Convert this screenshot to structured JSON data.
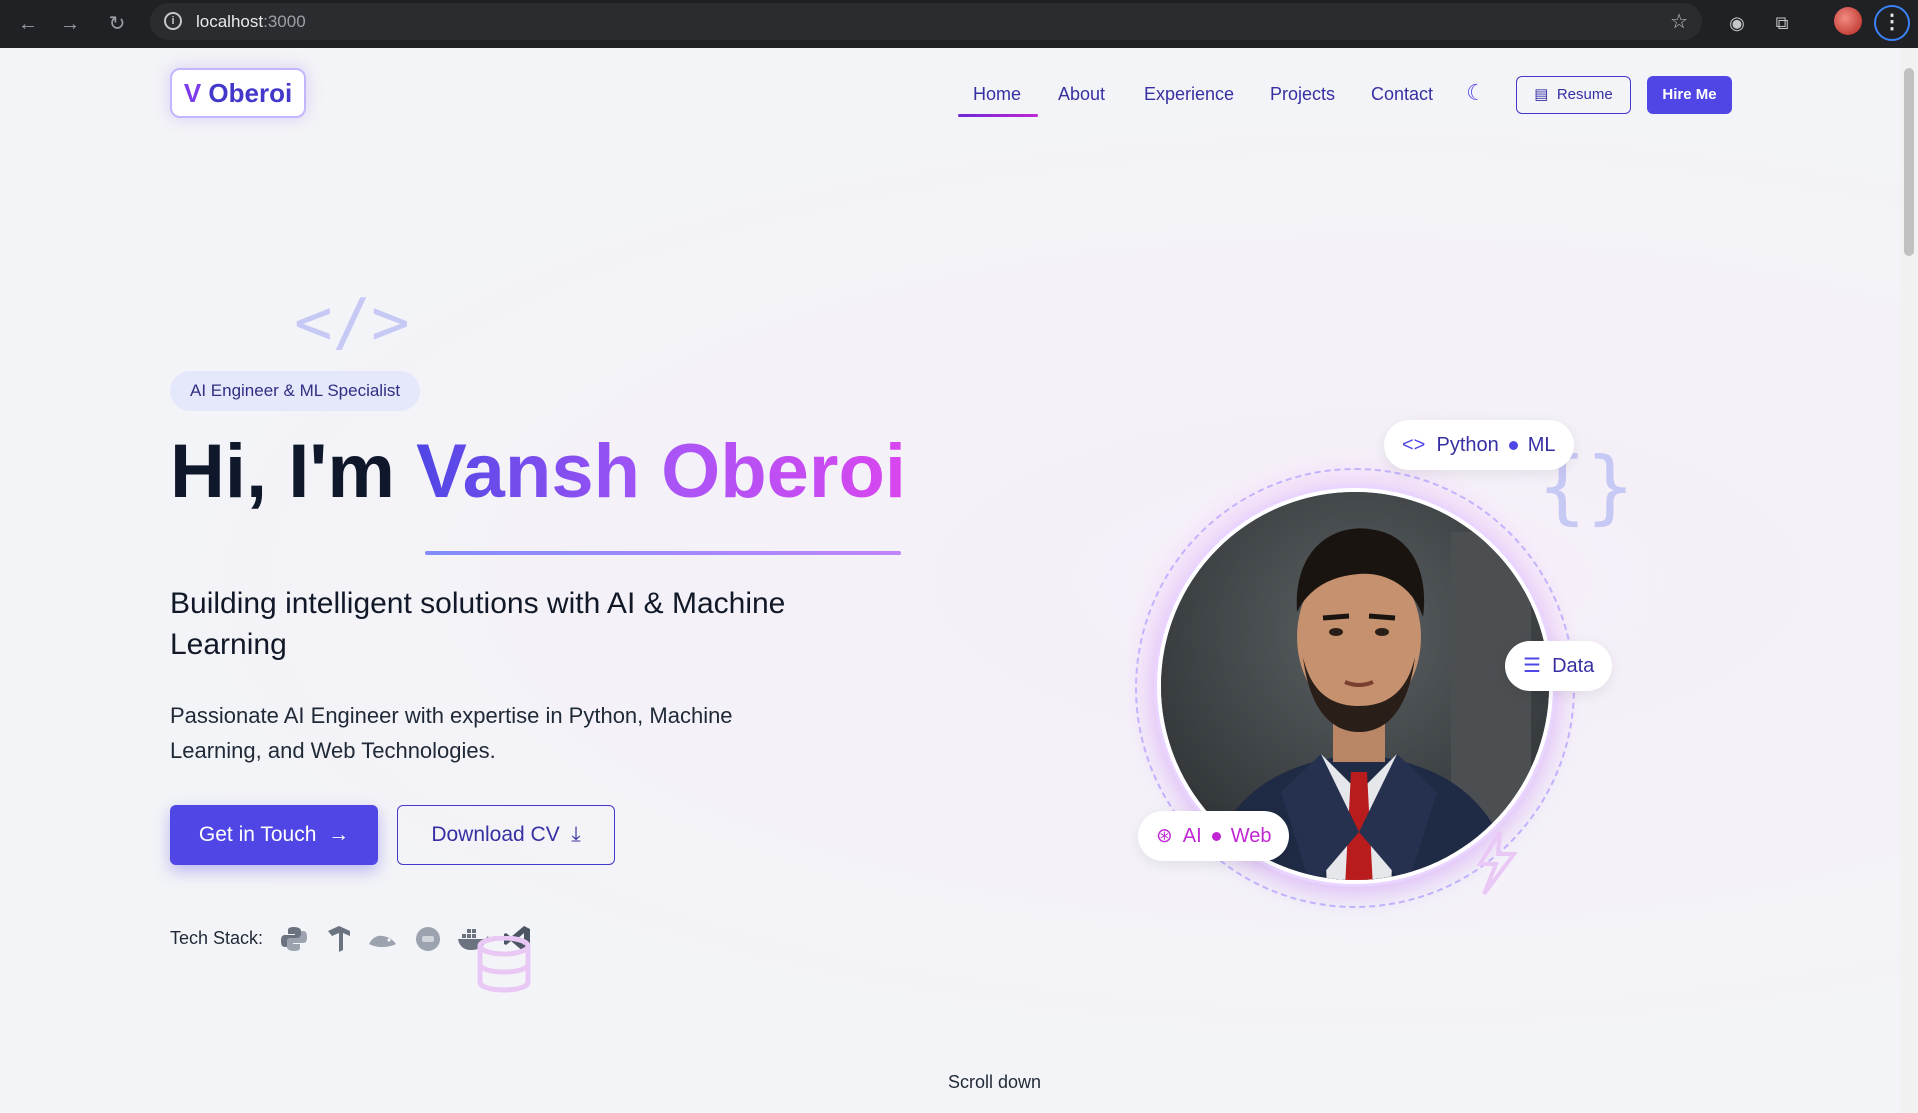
{
  "browser": {
    "url_host": "localhost",
    "url_port": ":3000",
    "icons": {
      "back": "back-arrow-icon",
      "forward": "forward-arrow-icon",
      "reload": "reload-icon",
      "info": "site-info-icon",
      "star": "bookmark-star-icon",
      "extension1": "extension-icon",
      "extensions": "puzzle-icon",
      "menu": "kebab-menu-icon"
    }
  },
  "header": {
    "logo_letter": "V",
    "logo_name": "Oberoi",
    "nav": [
      "Home",
      "About",
      "Experience",
      "Projects",
      "Contact"
    ],
    "active_nav": "Home",
    "resume_label": "Resume",
    "hire_label": "Hire Me"
  },
  "hero": {
    "badge": "AI Engineer & ML Specialist",
    "title_prefix": "Hi, I'm",
    "title_name": "Vansh Oberoi",
    "subtitle": "Building intelligent solutions with AI & Machine Learning",
    "description": "Passionate AI Engineer with expertise in Python, Machine Learning, and Web Technologies.",
    "primary_cta": "Get in Touch",
    "secondary_cta": "Download CV",
    "tech_label": "Tech Stack:",
    "tech_icons": [
      "python-icon",
      "tensorflow-icon",
      "mysql-icon",
      "database-icon",
      "docker-icon",
      "vscode-icon"
    ]
  },
  "profile": {
    "chip_top_a": "Python",
    "chip_top_b": "ML",
    "chip_right": "Data",
    "chip_left_a": "AI",
    "chip_left_b": "Web"
  },
  "scroll": {
    "label": "Scroll down"
  },
  "colors": {
    "primary": "#4f46e5",
    "accent_purple": "#a855f7",
    "accent_pink": "#d946ef",
    "text_dark": "#0f172a"
  }
}
